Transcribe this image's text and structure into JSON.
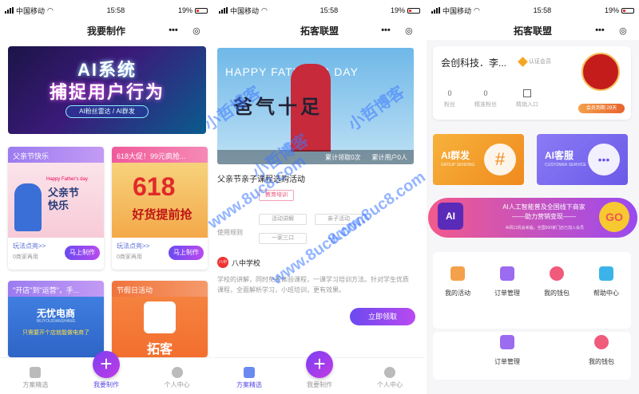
{
  "status": {
    "carrier": "中国移动",
    "time": "15:58",
    "battery": "19%"
  },
  "capsule": {
    "more": "•••",
    "close": "◎"
  },
  "panel1": {
    "title": "我要制作",
    "banner": {
      "line1": "AI系统",
      "line2": "捕捉用户行为",
      "pill": "AI粉丝雷达 / AI群发"
    },
    "cards": [
      {
        "header": "父亲节快乐",
        "img_text": "父亲节\n快乐",
        "img_small": "Happy Father's day",
        "link": "玩法点亮>>",
        "uses": "0商家再用",
        "button": "马上制作",
        "header_color": "#9b7bf0"
      },
      {
        "header": "618大促！99元疯抢...",
        "img_big": "618",
        "img_sub": "好货提前抢",
        "link": "玩法点亮>>",
        "uses": "0商家再用",
        "button": "马上制作",
        "header_color": "#f05a9b"
      },
      {
        "header": "\"开店\"到\"运营\"，手...",
        "img_text": "无忧电商",
        "img_small": "WUYOUDIANSHANG",
        "img_sub": "只需要开个店就能做电商了",
        "header_color": "#9b7bf0"
      },
      {
        "header": "节假日活动",
        "img_text": "拓客",
        "header_color": "#f0733b"
      }
    ],
    "tabs": [
      "方案精选",
      "我要制作",
      "个人中心"
    ]
  },
  "panel2": {
    "title": "拓客联盟",
    "hero": {
      "heading": "HAPPY FATHER'S DAY",
      "big": "爸气十足",
      "views": "累计领取0次",
      "used": "累计用户0人"
    },
    "activity_title": "父亲节亲子课程选购活动",
    "tags": [
      "教育培训",
      "活动讲解",
      "亲子活动",
      "使用规则",
      "一家三口"
    ],
    "usage_label": "使用规则",
    "section": "八中学校",
    "section_logo": "八中",
    "paragraph": "学校的讲解，同时免费体验课程，一课学习培训方法。针对学生优质课程，全面解析学习，小班培训，更有效果。",
    "claim_button": "立即领取",
    "tabs": [
      "方案精选",
      "我要制作",
      "个人中心"
    ]
  },
  "panel3": {
    "title": "拓客联盟",
    "profile": {
      "name": "会创科技．李...",
      "vip_label": "认证会员",
      "stats": [
        {
          "value": "0",
          "label": "粉丝"
        },
        {
          "value": "0",
          "label": "精准粉丝"
        },
        {
          "value": "",
          "label": "精销入口"
        }
      ],
      "seal": "中国会销",
      "vip_badge": "会员到期 29天"
    },
    "features": [
      {
        "title": "AI群发",
        "sub": "GROUP SENDING",
        "color": "#f5a623"
      },
      {
        "title": "AI客服",
        "sub": "CUSTOMER SERVICE",
        "color": "#7b6cf0"
      }
    ],
    "promo": {
      "logo": "AI",
      "line1": "AI人工智能普及全国线下商家",
      "line2": "——助力营销变现——",
      "line3": "AI风口机会来临，全国500家门店已加入会员",
      "go": "GO"
    },
    "menu": [
      "我的活动",
      "订单管理",
      "我的钱包",
      "帮助中心"
    ],
    "menu2": [
      "订单管理",
      "我的钱包"
    ]
  },
  "watermark": [
    "小哲博客",
    "小哲博客",
    "www.8uc8.com",
    "www.8uc8.com",
    "www.8uc8.com",
    "小哲博客"
  ],
  "colors": {
    "accent": "#6b4af0",
    "pink": "#f05a9b",
    "orange": "#f5a623"
  }
}
